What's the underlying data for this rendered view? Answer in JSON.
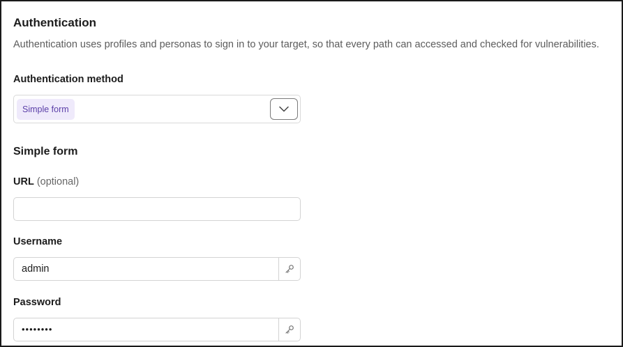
{
  "authentication": {
    "title": "Authentication",
    "description": "Authentication uses profiles and personas to sign in to your target, so that every path can accessed and checked for vulnerabilities."
  },
  "auth_method": {
    "label": "Authentication method",
    "selected": "Simple form"
  },
  "simple_form": {
    "title": "Simple form",
    "url": {
      "label": "URL",
      "optional_label": "(optional)",
      "value": ""
    },
    "username": {
      "label": "Username",
      "value": "admin"
    },
    "password": {
      "label": "Password",
      "value": "••••••••"
    }
  },
  "icons": {
    "select_toggle": "chevron-down-icon",
    "username_action": "key-icon",
    "password_action": "key-icon"
  },
  "colors": {
    "chip_background": "#efeafb",
    "chip_text": "#5b3fa8",
    "muted_text": "#5c5c5c"
  }
}
